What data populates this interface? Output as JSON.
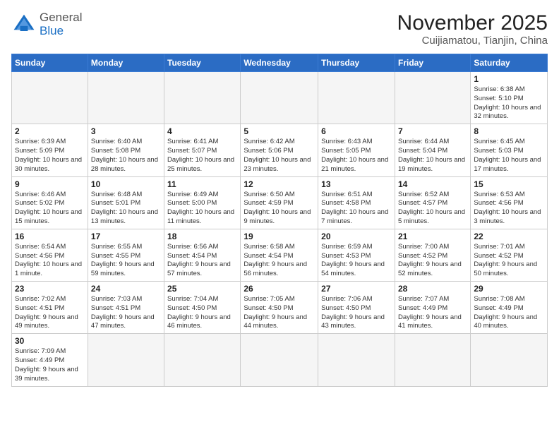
{
  "header": {
    "logo_general": "General",
    "logo_blue": "Blue",
    "title": "November 2025",
    "subtitle": "Cuijiamatou, Tianjin, China"
  },
  "weekdays": [
    "Sunday",
    "Monday",
    "Tuesday",
    "Wednesday",
    "Thursday",
    "Friday",
    "Saturday"
  ],
  "weeks": [
    [
      {
        "day": "",
        "info": ""
      },
      {
        "day": "",
        "info": ""
      },
      {
        "day": "",
        "info": ""
      },
      {
        "day": "",
        "info": ""
      },
      {
        "day": "",
        "info": ""
      },
      {
        "day": "",
        "info": ""
      },
      {
        "day": "1",
        "info": "Sunrise: 6:38 AM\nSunset: 5:10 PM\nDaylight: 10 hours and 32 minutes."
      }
    ],
    [
      {
        "day": "2",
        "info": "Sunrise: 6:39 AM\nSunset: 5:09 PM\nDaylight: 10 hours and 30 minutes."
      },
      {
        "day": "3",
        "info": "Sunrise: 6:40 AM\nSunset: 5:08 PM\nDaylight: 10 hours and 28 minutes."
      },
      {
        "day": "4",
        "info": "Sunrise: 6:41 AM\nSunset: 5:07 PM\nDaylight: 10 hours and 25 minutes."
      },
      {
        "day": "5",
        "info": "Sunrise: 6:42 AM\nSunset: 5:06 PM\nDaylight: 10 hours and 23 minutes."
      },
      {
        "day": "6",
        "info": "Sunrise: 6:43 AM\nSunset: 5:05 PM\nDaylight: 10 hours and 21 minutes."
      },
      {
        "day": "7",
        "info": "Sunrise: 6:44 AM\nSunset: 5:04 PM\nDaylight: 10 hours and 19 minutes."
      },
      {
        "day": "8",
        "info": "Sunrise: 6:45 AM\nSunset: 5:03 PM\nDaylight: 10 hours and 17 minutes."
      }
    ],
    [
      {
        "day": "9",
        "info": "Sunrise: 6:46 AM\nSunset: 5:02 PM\nDaylight: 10 hours and 15 minutes."
      },
      {
        "day": "10",
        "info": "Sunrise: 6:48 AM\nSunset: 5:01 PM\nDaylight: 10 hours and 13 minutes."
      },
      {
        "day": "11",
        "info": "Sunrise: 6:49 AM\nSunset: 5:00 PM\nDaylight: 10 hours and 11 minutes."
      },
      {
        "day": "12",
        "info": "Sunrise: 6:50 AM\nSunset: 4:59 PM\nDaylight: 10 hours and 9 minutes."
      },
      {
        "day": "13",
        "info": "Sunrise: 6:51 AM\nSunset: 4:58 PM\nDaylight: 10 hours and 7 minutes."
      },
      {
        "day": "14",
        "info": "Sunrise: 6:52 AM\nSunset: 4:57 PM\nDaylight: 10 hours and 5 minutes."
      },
      {
        "day": "15",
        "info": "Sunrise: 6:53 AM\nSunset: 4:56 PM\nDaylight: 10 hours and 3 minutes."
      }
    ],
    [
      {
        "day": "16",
        "info": "Sunrise: 6:54 AM\nSunset: 4:56 PM\nDaylight: 10 hours and 1 minute."
      },
      {
        "day": "17",
        "info": "Sunrise: 6:55 AM\nSunset: 4:55 PM\nDaylight: 9 hours and 59 minutes."
      },
      {
        "day": "18",
        "info": "Sunrise: 6:56 AM\nSunset: 4:54 PM\nDaylight: 9 hours and 57 minutes."
      },
      {
        "day": "19",
        "info": "Sunrise: 6:58 AM\nSunset: 4:54 PM\nDaylight: 9 hours and 56 minutes."
      },
      {
        "day": "20",
        "info": "Sunrise: 6:59 AM\nSunset: 4:53 PM\nDaylight: 9 hours and 54 minutes."
      },
      {
        "day": "21",
        "info": "Sunrise: 7:00 AM\nSunset: 4:52 PM\nDaylight: 9 hours and 52 minutes."
      },
      {
        "day": "22",
        "info": "Sunrise: 7:01 AM\nSunset: 4:52 PM\nDaylight: 9 hours and 50 minutes."
      }
    ],
    [
      {
        "day": "23",
        "info": "Sunrise: 7:02 AM\nSunset: 4:51 PM\nDaylight: 9 hours and 49 minutes."
      },
      {
        "day": "24",
        "info": "Sunrise: 7:03 AM\nSunset: 4:51 PM\nDaylight: 9 hours and 47 minutes."
      },
      {
        "day": "25",
        "info": "Sunrise: 7:04 AM\nSunset: 4:50 PM\nDaylight: 9 hours and 46 minutes."
      },
      {
        "day": "26",
        "info": "Sunrise: 7:05 AM\nSunset: 4:50 PM\nDaylight: 9 hours and 44 minutes."
      },
      {
        "day": "27",
        "info": "Sunrise: 7:06 AM\nSunset: 4:50 PM\nDaylight: 9 hours and 43 minutes."
      },
      {
        "day": "28",
        "info": "Sunrise: 7:07 AM\nSunset: 4:49 PM\nDaylight: 9 hours and 41 minutes."
      },
      {
        "day": "29",
        "info": "Sunrise: 7:08 AM\nSunset: 4:49 PM\nDaylight: 9 hours and 40 minutes."
      }
    ],
    [
      {
        "day": "30",
        "info": "Sunrise: 7:09 AM\nSunset: 4:49 PM\nDaylight: 9 hours and 39 minutes."
      },
      {
        "day": "",
        "info": ""
      },
      {
        "day": "",
        "info": ""
      },
      {
        "day": "",
        "info": ""
      },
      {
        "day": "",
        "info": ""
      },
      {
        "day": "",
        "info": ""
      },
      {
        "day": "",
        "info": ""
      }
    ]
  ]
}
